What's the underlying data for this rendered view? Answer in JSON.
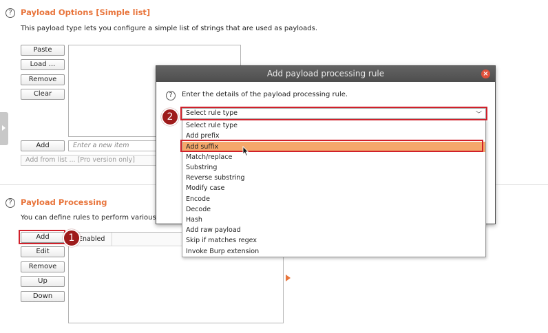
{
  "payload_options": {
    "title": "Payload Options [Simple list]",
    "description": "This payload type lets you configure a simple list of strings that are used as payloads.",
    "buttons": {
      "paste": "Paste",
      "load": "Load ...",
      "remove": "Remove",
      "clear": "Clear",
      "add": "Add"
    },
    "new_item_placeholder": "Enter a new item",
    "add_from_list": "Add from list ... [Pro version only]"
  },
  "payload_processing": {
    "title": "Payload Processing",
    "description": "You can define rules to perform various proce",
    "buttons": {
      "add": "Add",
      "edit": "Edit",
      "remove": "Remove",
      "up": "Up",
      "down": "Down"
    },
    "columns": {
      "enabled": "Enabled"
    }
  },
  "dialog": {
    "title": "Add payload processing rule",
    "close_glyph": "×",
    "instruction": "Enter the details of the payload processing rule.",
    "select_value": "Select rule type",
    "options": [
      "Select rule type",
      "Add prefix",
      "Add suffix",
      "Match/replace",
      "Substring",
      "Reverse substring",
      "Modify case",
      "Encode",
      "Decode",
      "Hash",
      "Add raw payload",
      "Skip if matches regex",
      "Invoke Burp extension"
    ],
    "highlighted_option": "Add suffix"
  },
  "annotations": {
    "step1": "1",
    "step2": "2"
  },
  "icons": {
    "help": "?",
    "chevron": "﹀"
  },
  "colors": {
    "accent": "#e8743b",
    "highlight": "#f5a86b",
    "annotation": "#d0202a"
  }
}
